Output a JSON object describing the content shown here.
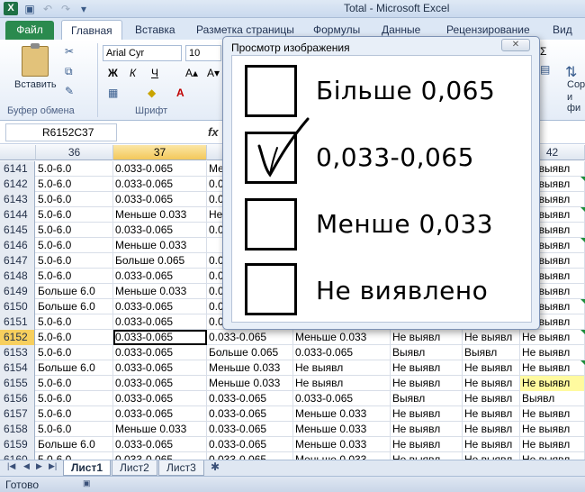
{
  "window": {
    "title": "Total  -  Microsoft Excel",
    "app_icon": "X"
  },
  "ribbon": {
    "file_tab": "Файл",
    "tabs": [
      "Главная",
      "Вставка",
      "Разметка страницы",
      "Формулы",
      "Данные",
      "Рецензирование",
      "Вид"
    ],
    "paste_label": "Вставить",
    "clipboard_group": "Буфер обмена",
    "font_group": "Шрифт",
    "font_name": "Arial Cyr",
    "font_size": "10",
    "bold": "Ж",
    "italic": "К",
    "underline": "Ч",
    "sort_label_1": "Сор",
    "sort_label_2": "и фи"
  },
  "formula_bar": {
    "name_box": "R6152C37",
    "fx": "fx"
  },
  "grid": {
    "columns": [
      {
        "label": "36",
        "selected": false
      },
      {
        "label": "37",
        "selected": true
      },
      {
        "label": "",
        "selected": false
      },
      {
        "label": "",
        "selected": false
      },
      {
        "label": "",
        "selected": false
      },
      {
        "label": "",
        "selected": false
      },
      {
        "label": "42",
        "selected": false
      }
    ],
    "rows": [
      {
        "n": "6141",
        "c": [
          "5.0-6.0",
          "0.033-0.065",
          "Мен",
          "",
          "",
          "",
          "Не выявл"
        ]
      },
      {
        "n": "6142",
        "c": [
          "5.0-6.0",
          "0.033-0.065",
          "0.03",
          "",
          "",
          "",
          "Не выявл"
        ]
      },
      {
        "n": "6143",
        "c": [
          "5.0-6.0",
          "0.033-0.065",
          "0.03",
          "",
          "",
          "",
          "Не выявл"
        ]
      },
      {
        "n": "6144",
        "c": [
          "5.0-6.0",
          "Меньше 0.033",
          "Не в",
          "",
          "",
          "",
          "Не выявл"
        ]
      },
      {
        "n": "6145",
        "c": [
          "5.0-6.0",
          "0.033-0.065",
          "0.03",
          "",
          "",
          "",
          "Не выявл"
        ]
      },
      {
        "n": "6146",
        "c": [
          "5.0-6.0",
          "Меньше 0.033",
          "",
          "",
          "",
          "",
          "Не выявл"
        ]
      },
      {
        "n": "6147",
        "c": [
          "5.0-6.0",
          "Больше 0.065",
          "0.03",
          "",
          "",
          "",
          "Не выявл"
        ]
      },
      {
        "n": "6148",
        "c": [
          "5.0-6.0",
          "0.033-0.065",
          "0.03",
          "",
          "",
          "",
          "Не выявл"
        ]
      },
      {
        "n": "6149",
        "c": [
          "Больше 6.0",
          "Меньше 0.033",
          "0.03",
          "",
          "",
          "",
          "Не выявл"
        ]
      },
      {
        "n": "6150",
        "c": [
          "Больше 6.0",
          "0.033-0.065",
          "0.03",
          "",
          "",
          "",
          "Не выявл"
        ]
      },
      {
        "n": "6151",
        "c": [
          "5.0-6.0",
          "0.033-0.065",
          "0.03",
          "",
          "",
          "",
          "Не выявл"
        ]
      },
      {
        "n": "6152",
        "c": [
          "5.0-6.0",
          "0.033-0.065",
          "0.033-0.065",
          "Меньше 0.033",
          "Не выявл",
          "Не выявл",
          "Не выявл"
        ]
      },
      {
        "n": "6153",
        "c": [
          "5.0-6.0",
          "0.033-0.065",
          "Больше 0.065",
          "0.033-0.065",
          "Выявл",
          "Выявл",
          "Не выявл"
        ]
      },
      {
        "n": "6154",
        "c": [
          "Больше 6.0",
          "0.033-0.065",
          "Меньше 0.033",
          "Не выявл",
          "Не выявл",
          "Не выявл",
          "Не выявл"
        ]
      },
      {
        "n": "6155",
        "c": [
          "5.0-6.0",
          "0.033-0.065",
          "Меньше 0.033",
          "Не выявл",
          "Не выявл",
          "Не выявл",
          "Не выявл"
        ]
      },
      {
        "n": "6156",
        "c": [
          "5.0-6.0",
          "0.033-0.065",
          "0.033-0.065",
          "0.033-0.065",
          "Выявл",
          "Не выявл",
          "Выявл"
        ]
      },
      {
        "n": "6157",
        "c": [
          "5.0-6.0",
          "0.033-0.065",
          "0.033-0.065",
          "Меньше 0.033",
          "Не выявл",
          "Не выявл",
          "Не выявл"
        ]
      },
      {
        "n": "6158",
        "c": [
          "5.0-6.0",
          "Меньше 0.033",
          "0.033-0.065",
          "Меньше 0.033",
          "Не выявл",
          "Не выявл",
          "Не выявл"
        ]
      },
      {
        "n": "6159",
        "c": [
          "Больше 6.0",
          "0.033-0.065",
          "0.033-0.065",
          "Меньше 0.033",
          "Не выявл",
          "Не выявл",
          "Не выявл"
        ]
      },
      {
        "n": "6160",
        "c": [
          "5.0-6.0",
          "0.033-0.065",
          "0.033-0.065",
          "Меньше 0.033",
          "Не выявл",
          "Не выявл",
          "Не выявл"
        ]
      }
    ]
  },
  "sheets": {
    "tabs": [
      "Лист1",
      "Лист2",
      "Лист3"
    ],
    "active": "Лист1"
  },
  "status": {
    "text": "Готово"
  },
  "dialog": {
    "title": "Просмотр изображения",
    "close": "✕",
    "options": [
      {
        "label": "Більше 0,065",
        "checked": false
      },
      {
        "label": "0,033-0,065",
        "checked": true
      },
      {
        "label": "Менше 0,033",
        "checked": false
      },
      {
        "label": "Не виявлено",
        "checked": false
      }
    ]
  },
  "colors": {
    "file_tab": "#2a8a4e",
    "selected_header": "#f3c85a",
    "highlight_cell": "#fffa9f"
  }
}
